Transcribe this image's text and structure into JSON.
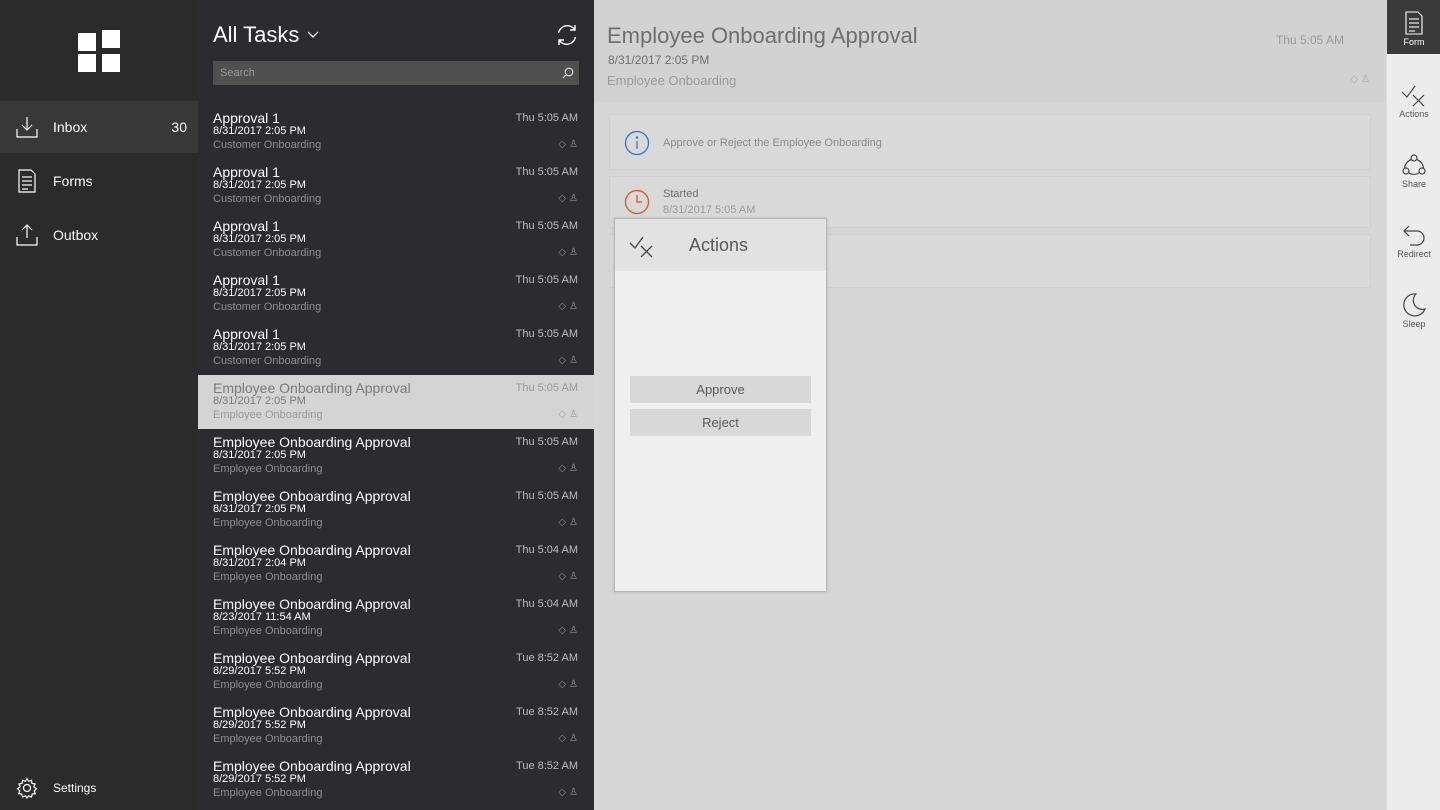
{
  "nav": {
    "items": [
      {
        "label": "Inbox",
        "count": "30",
        "icon": "inbox-download-icon"
      },
      {
        "label": "Forms",
        "icon": "form-document-icon"
      },
      {
        "label": "Outbox",
        "icon": "outbox-upload-icon"
      }
    ],
    "settings_label": "Settings"
  },
  "list": {
    "title": "All Tasks",
    "search_placeholder": "Search",
    "rows": [
      {
        "title": "Approval 1",
        "date": "8/31/2017 2:05 PM",
        "category": "Customer Onboarding",
        "time": "Thu 5:05 AM"
      },
      {
        "title": "Approval 1",
        "date": "8/31/2017 2:05 PM",
        "category": "Customer Onboarding",
        "time": "Thu 5:05 AM"
      },
      {
        "title": "Approval 1",
        "date": "8/31/2017 2:05 PM",
        "category": "Customer Onboarding",
        "time": "Thu 5:05 AM"
      },
      {
        "title": "Approval 1",
        "date": "8/31/2017 2:05 PM",
        "category": "Customer Onboarding",
        "time": "Thu 5:05 AM"
      },
      {
        "title": "Approval 1",
        "date": "8/31/2017 2:05 PM",
        "category": "Customer Onboarding",
        "time": "Thu 5:05 AM"
      },
      {
        "title": "Employee Onboarding Approval",
        "date": "8/31/2017 2:05 PM",
        "category": "Employee Onboarding",
        "time": "Thu 5:05 AM"
      },
      {
        "title": "Employee Onboarding Approval",
        "date": "8/31/2017 2:05 PM",
        "category": "Employee Onboarding",
        "time": "Thu 5:05 AM"
      },
      {
        "title": "Employee Onboarding Approval",
        "date": "8/31/2017 2:05 PM",
        "category": "Employee Onboarding",
        "time": "Thu 5:05 AM"
      },
      {
        "title": "Employee Onboarding Approval",
        "date": "8/31/2017 2:04 PM",
        "category": "Employee Onboarding",
        "time": "Thu 5:04 AM"
      },
      {
        "title": "Employee Onboarding Approval",
        "date": "8/23/2017 11:54 AM",
        "category": "Employee Onboarding",
        "time": "Thu 5:04 AM"
      },
      {
        "title": "Employee Onboarding Approval",
        "date": "8/29/2017 5:52 PM",
        "category": "Employee Onboarding",
        "time": "Tue 8:52 AM"
      },
      {
        "title": "Employee Onboarding Approval",
        "date": "8/29/2017 5:52 PM",
        "category": "Employee Onboarding",
        "time": "Tue 8:52 AM"
      },
      {
        "title": "Employee Onboarding Approval",
        "date": "8/29/2017 5:52 PM",
        "category": "Employee Onboarding",
        "time": "Tue 8:52 AM"
      }
    ]
  },
  "detail": {
    "title": "Employee Onboarding Approval",
    "date": "8/31/2017 2:05 PM",
    "category": "Employee Onboarding",
    "time": "Thu 5:05 AM",
    "info_text": "Approve or Reject the Employee Onboarding",
    "status_label": "Started",
    "status_date": "8/31/2017 5:05 AM"
  },
  "flyout": {
    "title": "Actions",
    "approve_label": "Approve",
    "reject_label": "Reject"
  },
  "commands": [
    {
      "label": "Form",
      "icon": "form-icon"
    },
    {
      "label": "Actions",
      "icon": "actions-check-cross-icon"
    },
    {
      "label": "Share",
      "icon": "share-icon"
    },
    {
      "label": "Redirect",
      "icon": "redirect-icon"
    },
    {
      "label": "Sleep",
      "icon": "moon-icon"
    }
  ],
  "colors": {
    "nav_bg": "#2b2b2b",
    "list_bg": "#2c2b30",
    "info_blue": "#2e7bbf",
    "clock_orange": "#d8602e"
  }
}
